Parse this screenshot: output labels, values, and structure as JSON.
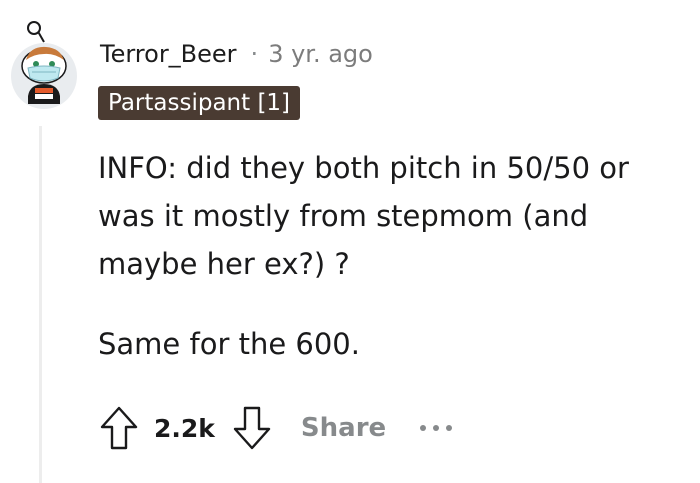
{
  "comment": {
    "author": "Terror_Beer",
    "separator": "·",
    "timestamp": "3 yr. ago",
    "flair": "Partassipant [1]",
    "paragraphs": [
      "INFO: did they both pitch in 50/50 or was it mostly from stepmom (and maybe her ex?) ?",
      "Same for the 600."
    ]
  },
  "actions": {
    "score": "2.2k",
    "share_label": "Share"
  },
  "colors": {
    "flair_bg": "#4a3b32",
    "muted": "#878a8c",
    "thread_line": "#ededed"
  },
  "icons": [
    "avatar-icon",
    "upvote-icon",
    "downvote-icon",
    "more-options-icon"
  ]
}
